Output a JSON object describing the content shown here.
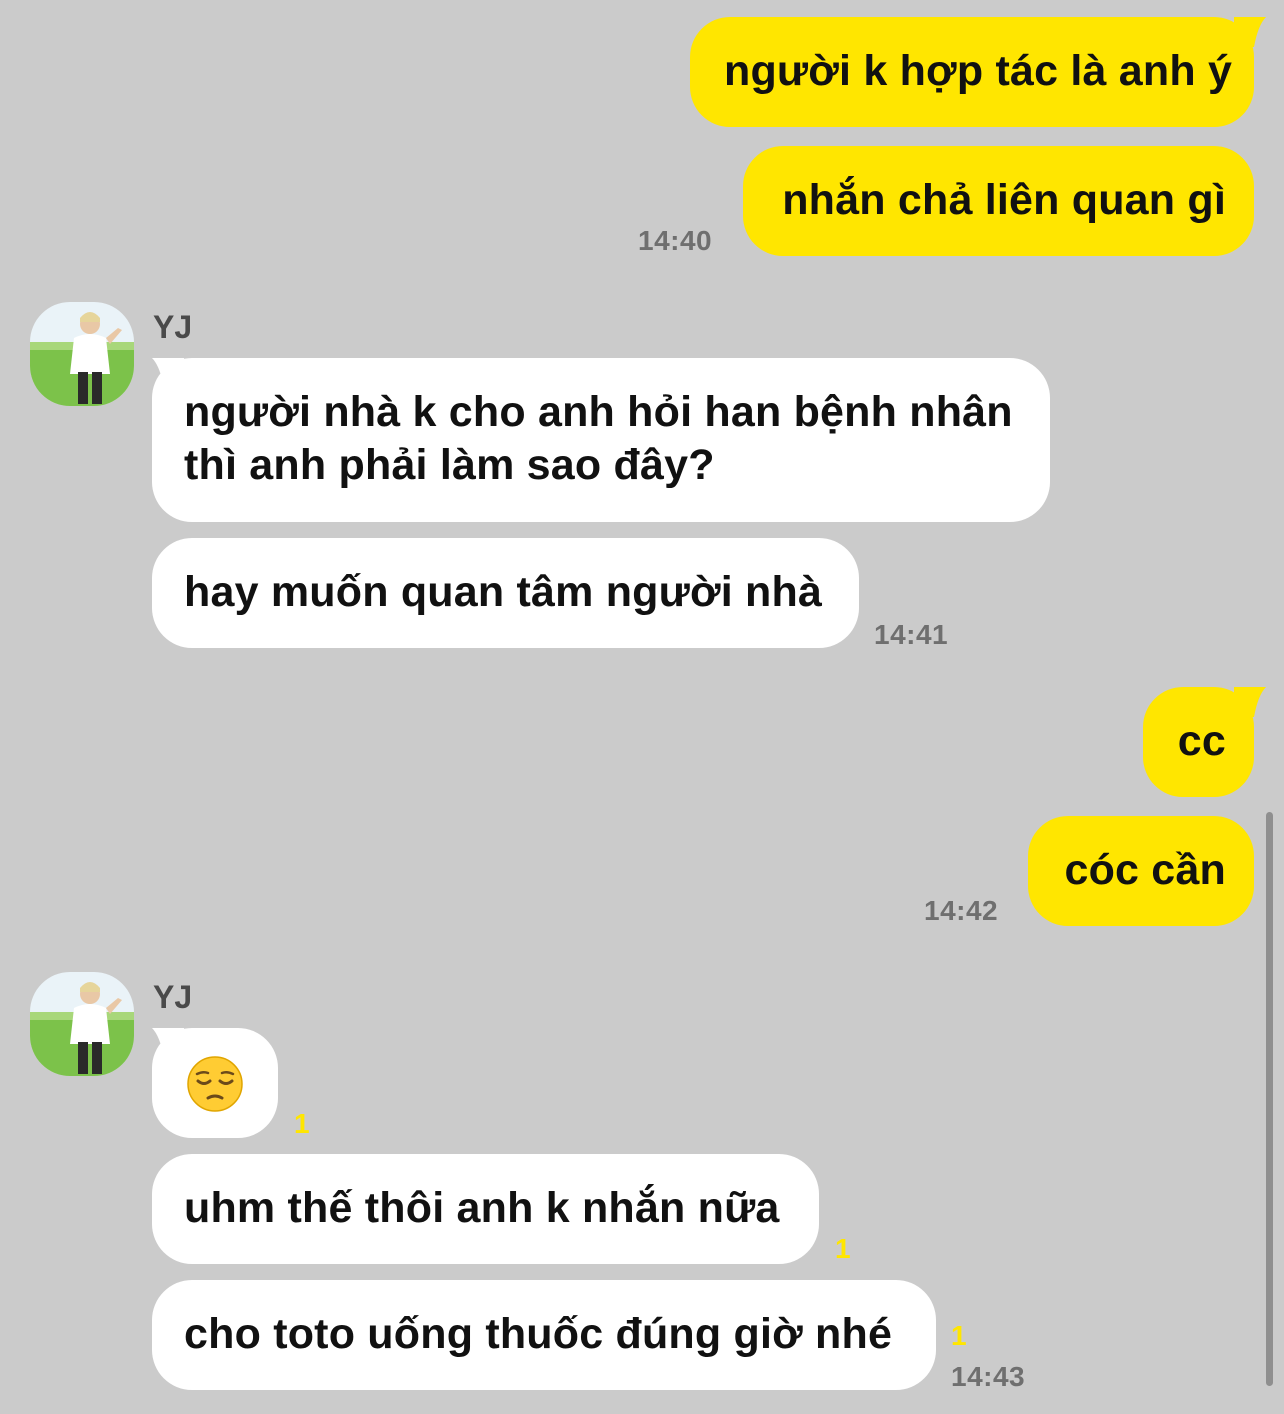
{
  "conversation": {
    "contact_name": "YJ",
    "messages": [
      {
        "from": "me",
        "text": "người k hợp tác là anh ý"
      },
      {
        "from": "me",
        "text": "nhắn chả liên quan gì",
        "time": "14:40"
      },
      {
        "from": "them",
        "lines": [
          "người nhà k cho anh hỏi han bệnh nhân",
          "thì anh phải làm sao đây?"
        ]
      },
      {
        "from": "them",
        "text": "hay muốn quan tâm người nhà",
        "time": "14:41"
      },
      {
        "from": "me",
        "text": "cc"
      },
      {
        "from": "me",
        "text": "cóc cần",
        "time": "14:42"
      },
      {
        "from": "them",
        "emoji": "pensive-face",
        "unread": "1"
      },
      {
        "from": "them",
        "text": "uhm thế thôi anh k nhắn nữa",
        "unread": "1"
      },
      {
        "from": "them",
        "text": "cho toto uống thuốc đúng giờ nhé",
        "unread": "1",
        "time": "14:43"
      }
    ]
  },
  "colors": {
    "background": "#cbcbcb",
    "my_bubble": "#ffe600",
    "their_bubble": "#ffffff",
    "unread_counter": "#ffe600",
    "timestamp": "#6f6f6f"
  }
}
